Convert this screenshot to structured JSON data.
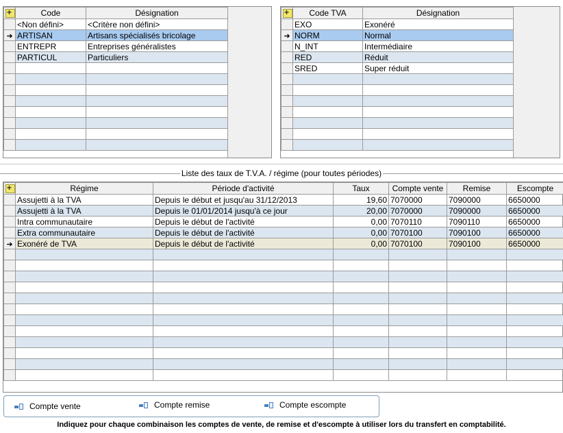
{
  "categories_grid": {
    "columns": [
      "Code",
      "Désignation"
    ],
    "rows": [
      {
        "code": "<Non défini>",
        "designation": "<Critère non défini>"
      },
      {
        "code": "ARTISAN",
        "designation": "Artisans spécialisés bricolage"
      },
      {
        "code": "ENTREPR",
        "designation": "Entreprises généralistes"
      },
      {
        "code": "PARTICUL",
        "designation": "Particuliers"
      }
    ],
    "selected_row": 1
  },
  "tva_grid": {
    "columns": [
      "Code TVA",
      "Désignation"
    ],
    "rows": [
      {
        "code": "EXO",
        "designation": "Exonéré"
      },
      {
        "code": "NORM",
        "designation": "Normal"
      },
      {
        "code": "N_INT",
        "designation": "Intermédiaire"
      },
      {
        "code": "RED",
        "designation": "Réduit"
      },
      {
        "code": "SRED",
        "designation": "Super réduit"
      }
    ],
    "selected_row": 1
  },
  "rates_section": {
    "title": "Liste des taux de T.V.A. / régime (pour toutes périodes)",
    "columns": [
      "Régime",
      "Période d'activité",
      "Taux",
      "Compte vente",
      "Remise",
      "Escompte"
    ],
    "rows": [
      {
        "regime": "Assujetti à la TVA",
        "periode": "Depuis le début et jusqu'au 31/12/2013",
        "taux": "19,60",
        "vente": "7070000",
        "remise": "7090000",
        "escompte": "6650000"
      },
      {
        "regime": "Assujetti à la TVA",
        "periode": "Depuis le 01/01/2014 jusqu'à ce jour",
        "taux": "20,00",
        "vente": "7070000",
        "remise": "7090000",
        "escompte": "6650000"
      },
      {
        "regime": "Intra communautaire",
        "periode": "Depuis le début de l'activité",
        "taux": "0,00",
        "vente": "7070110",
        "remise": "7090110",
        "escompte": "6650000"
      },
      {
        "regime": "Extra communautaire",
        "periode": "Depuis le début de l'activité",
        "taux": "0,00",
        "vente": "7070100",
        "remise": "7090100",
        "escompte": "6650000"
      },
      {
        "regime": "Exonéré de TVA",
        "periode": "Depuis le début de l'activité",
        "taux": "0,00",
        "vente": "7070100",
        "remise": "7090100",
        "escompte": "6650000"
      }
    ],
    "current_row": 4
  },
  "buttons": {
    "compte_vente": "Compte vente",
    "compte_remise": "Compte remise",
    "compte_escompte": "Compte escompte"
  },
  "footer_hint": "Indiquez pour chaque combinaison les comptes de vente, de remise et d'escompte à utiliser lors du transfert en comptabilité.",
  "icons": {
    "add": "add-row-icon",
    "row_pointer": "row-pointer-icon",
    "account": "account-link-icon"
  },
  "colors": {
    "selected_row": "#a9cbf0",
    "alt_row": "#dce6f0",
    "current_row": "#ece9d8",
    "add_button": "#f2e76a"
  }
}
